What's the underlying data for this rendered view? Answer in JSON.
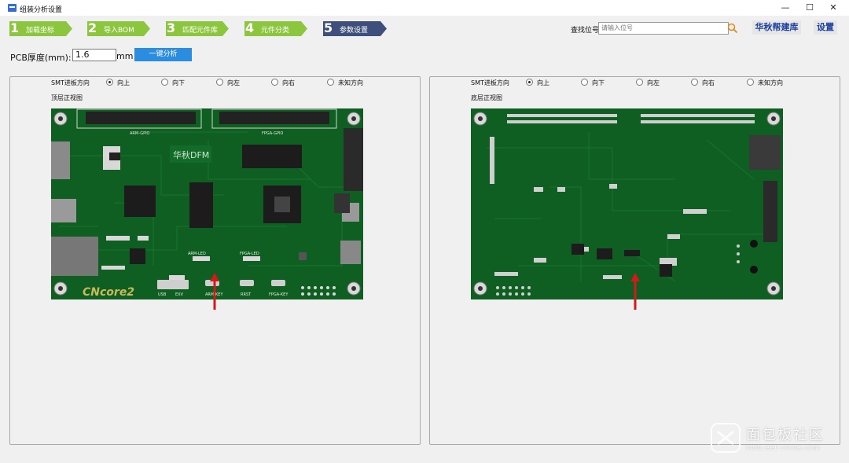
{
  "window": {
    "title": "组装分析设置",
    "controls": [
      "minimize",
      "maximize",
      "close"
    ]
  },
  "steps": [
    {
      "num": "1",
      "label": "加载坐标",
      "active": false
    },
    {
      "num": "2",
      "label": "导入BOM",
      "active": false
    },
    {
      "num": "3",
      "label": "匹配元件库",
      "active": false
    },
    {
      "num": "4",
      "label": "元件分类",
      "active": false
    },
    {
      "num": "5",
      "label": "参数设置",
      "active": true
    }
  ],
  "search": {
    "label": "查找位号",
    "placeholder": "请输入位号",
    "icon": "search-icon"
  },
  "header_links": {
    "library": "华秋帮建库",
    "settings": "设置"
  },
  "pcb": {
    "thickness_label": "PCB厚度(mm):",
    "thickness_value": "1.6",
    "unit": "mm",
    "analyze_button": "一键分析"
  },
  "panels": [
    {
      "direction_label": "SMT进板方向",
      "options": [
        "向上",
        "向下",
        "向左",
        "向右",
        "未知方向"
      ],
      "selected": "向上",
      "view_label": "顶层正视图",
      "board_text": {
        "header1": "ARM-GPIO",
        "header2": "FPGA-GPIO",
        "logo": "华秋DFM",
        "arm_led": "ARM-LED",
        "fpga_led": "FPGA-LED",
        "usb": "USB",
        "exv": "EXV",
        "arm_key": "ARM-KEY",
        "rest": "RRST",
        "fpga_key": "FPGA-KEY",
        "brand": "CNcore2"
      }
    },
    {
      "direction_label": "SMT进板方向",
      "options": [
        "向上",
        "向下",
        "向左",
        "向右",
        "未知方向"
      ],
      "selected": "向上",
      "view_label": "底层正视图"
    }
  ],
  "watermark": {
    "text": "面包板社区",
    "sub": "mbb.eet-china.com"
  },
  "colors": {
    "step_green": "#8cc63f",
    "step_active": "#3d4f7a",
    "board_green": "#0e5c21",
    "accent_blue": "#2a8de0",
    "arrow_red": "#d11a1a"
  }
}
